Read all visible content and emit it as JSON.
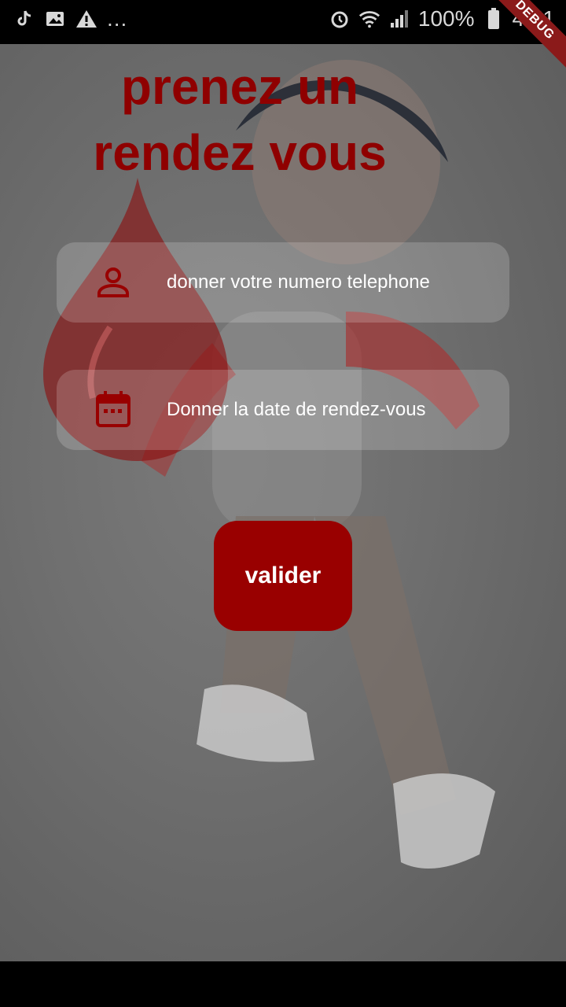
{
  "status_bar": {
    "left_icons": [
      "tiktok-icon",
      "image-icon",
      "warning-icon"
    ],
    "more_indicator": "...",
    "battery_percent": "100%",
    "time": "4:51",
    "right_icons": [
      "alarm-icon",
      "wifi-icon",
      "signal-icon",
      "battery-icon"
    ]
  },
  "debug_banner": "DEBUG",
  "title": {
    "line1": "prenez un",
    "line2": "rendez vous"
  },
  "form": {
    "phone_field": {
      "placeholder": "donner votre numero telephone",
      "icon": "person-icon"
    },
    "date_field": {
      "placeholder": "Donner la date de rendez-vous",
      "icon": "calendar-icon"
    },
    "submit_label": "valider"
  },
  "colors": {
    "accent": "#990000",
    "title": "#8f0000",
    "field_bg": "rgba(255,255,255,0.18)",
    "overlay": "#6f6f6f"
  }
}
